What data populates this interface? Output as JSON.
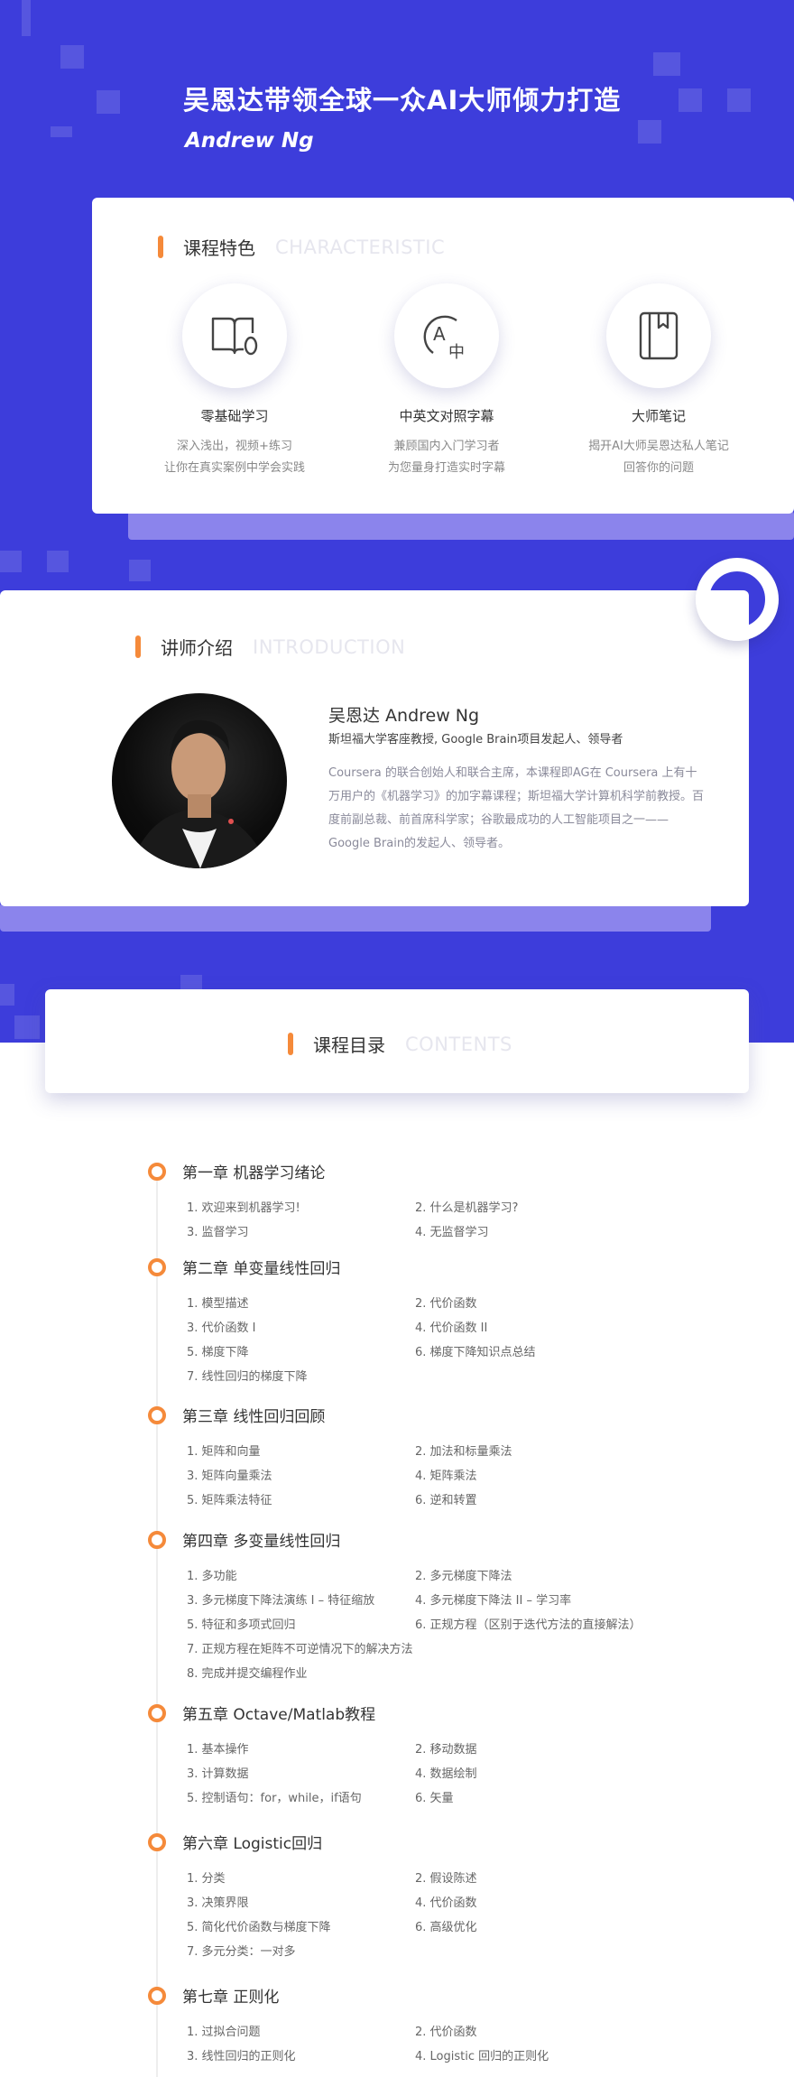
{
  "hero": {
    "title": "吴恩达带领全球一众AI大师倾力打造",
    "subtitle": "Andrew Ng"
  },
  "characteristic": {
    "title_cn": "课程特色",
    "title_en": "CHARACTERISTIC",
    "features": [
      {
        "icon": "book-zero-icon",
        "title": "零基础学习",
        "desc1": "深入浅出，视频+练习",
        "desc2": "让你在真实案例中学会实践"
      },
      {
        "icon": "translate-icon",
        "title": "中英文对照字幕",
        "desc1": "兼顾国内入门学习者",
        "desc2": "为您量身打造实时字幕"
      },
      {
        "icon": "notebook-icon",
        "title": "大师笔记",
        "desc1": "揭开AI大师吴恩达私人笔记",
        "desc2": "回答你的问题"
      }
    ]
  },
  "introduction": {
    "title_cn": "讲师介绍",
    "title_en": "INTRODUCTION",
    "name": "吴恩达 Andrew Ng",
    "role": "斯坦福大学客座教授, Google Brain项目发起人、领导者",
    "bio": "Coursera 的联合创始人和联合主席，本课程即AG在 Coursera 上有十万用户的《机器学习》的加字幕课程；斯坦福大学计算机科学前教授。百度前副总裁、前首席科学家；谷歌最成功的人工智能项目之一——Google Brain的发起人、领导者。"
  },
  "contents": {
    "title_cn": "课程目录",
    "title_en": "CONTENTS",
    "chapters": [
      {
        "title": "第一章 机器学习绪论",
        "lessons": [
          "1. 欢迎来到机器学习!",
          "2. 什么是机器学习?",
          "3. 监督学习",
          "4. 无监督学习"
        ]
      },
      {
        "title": "第二章 单变量线性回归",
        "lessons": [
          "1. 模型描述",
          "2. 代价函数",
          "3. 代价函数 I",
          "4. 代价函数 II",
          "5. 梯度下降",
          "6. 梯度下降知识点总结",
          "7. 线性回归的梯度下降"
        ]
      },
      {
        "title": "第三章 线性回归回顾",
        "lessons": [
          "1. 矩阵和向量",
          "2. 加法和标量乘法",
          "3. 矩阵向量乘法",
          "4. 矩阵乘法",
          "5. 矩阵乘法特征",
          "6. 逆和转置"
        ]
      },
      {
        "title": "第四章 多变量线性回归",
        "lessons": [
          "1. 多功能",
          "2. 多元梯度下降法",
          "3. 多元梯度下降法演练 I – 特征缩放",
          "4. 多元梯度下降法 II – 学习率",
          "5. 特征和多项式回归",
          "6. 正规方程（区别于迭代方法的直接解法）",
          "7. 正规方程在矩阵不可逆情况下的解决方法",
          "8. 完成并提交编程作业"
        ]
      },
      {
        "title": "第五章 Octave/Matlab教程",
        "lessons": [
          "1. 基本操作",
          "2. 移动数据",
          "3. 计算数据",
          "4. 数据绘制",
          "5. 控制语句：for，while，if语句",
          "6. 矢量"
        ]
      },
      {
        "title": "第六章 Logistic回归",
        "lessons": [
          "1. 分类",
          "2. 假设陈述",
          "3. 决策界限",
          "4. 代价函数",
          "5. 简化代价函数与梯度下降",
          "6. 高级优化",
          "7. 多元分类：一对多"
        ]
      },
      {
        "title": "第七章 正则化",
        "lessons": [
          "1. 过拟合问题",
          "2. 代价函数",
          "3. 线性回归的正则化",
          "4. Logistic 回归的正则化"
        ]
      }
    ]
  },
  "colors": {
    "brand_blue": "#3d3ddb",
    "accent_orange": "#f58a3a",
    "shadow_purple": "#8b84ec"
  }
}
